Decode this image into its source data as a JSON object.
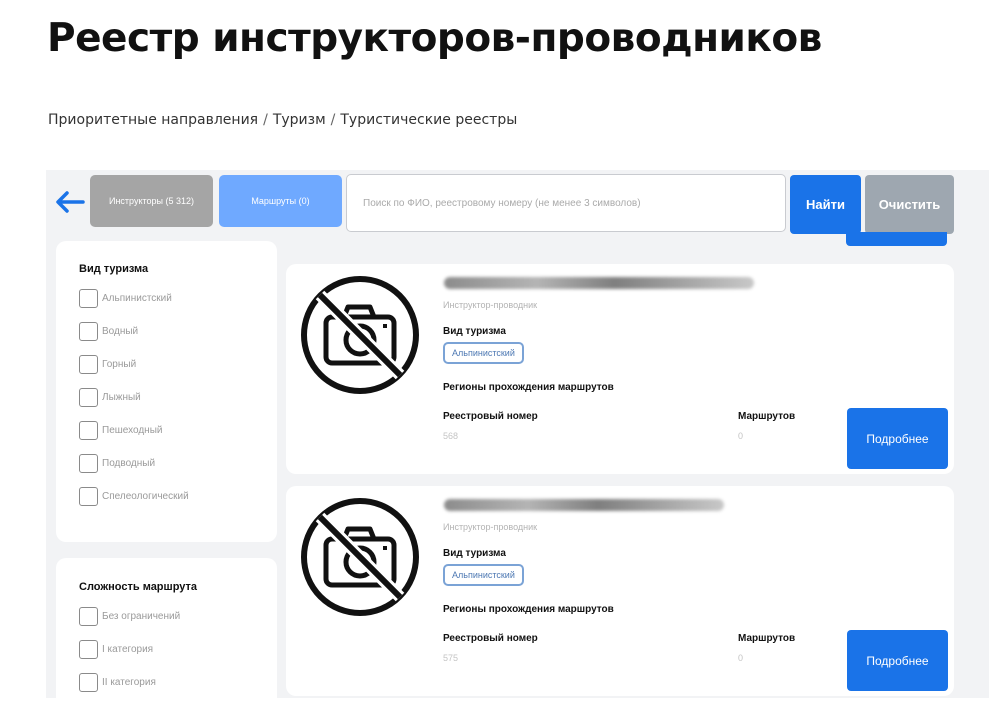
{
  "page": {
    "title": "Реестр инструкторов-проводников",
    "breadcrumb": [
      "Приоритетные направления",
      "Туризм",
      "Туристические реестры"
    ],
    "breadcrumb_separator": "/"
  },
  "toolbar": {
    "back_icon": "arrow-left-icon",
    "tab_instructors": "Инструкторы  (5 312)",
    "tab_routes": "Маршруты (0)",
    "search_placeholder": "Поиск по ФИО, реестровому номеру (не менее 3 символов)",
    "find_label": "Найти",
    "clear_label": "Очистить"
  },
  "filters": {
    "tourism": {
      "title": "Вид туризма",
      "options": [
        "Альпинистский",
        "Водный",
        "Горный",
        "Лыжный",
        "Пешеходный",
        "Подводный",
        "Спелеологический"
      ]
    },
    "complexity": {
      "title": "Сложность маршрута",
      "options": [
        "Без ограничений",
        "I категория",
        "II категория"
      ]
    }
  },
  "cards": [
    {
      "photo_icon": "no-photo-icon",
      "role": "Инструктор-проводник",
      "tourism_label": "Вид туризма",
      "tourism_tag": "Альпинистский",
      "regions_label": "Регионы прохождения маршрутов",
      "registry_label": "Реестровый номер",
      "registry_value": "568",
      "routes_label": "Маршрутов",
      "routes_value": "0",
      "more_label": "Подробнее"
    },
    {
      "photo_icon": "no-photo-icon",
      "role": "Инструктор-проводник",
      "tourism_label": "Вид туризма",
      "tourism_tag": "Альпинистский",
      "regions_label": "Регионы прохождения маршрутов",
      "registry_label": "Реестровый номер",
      "registry_value": "575",
      "routes_label": "Маршрутов",
      "routes_value": "0",
      "more_label": "Подробнее"
    }
  ],
  "colors": {
    "primary": "#1a73e8",
    "tab_active": "#6fa9ff",
    "tab_inactive": "#a5a5a5",
    "clear_button": "#9ea7b0",
    "panel_background": "#f2f3f5"
  }
}
